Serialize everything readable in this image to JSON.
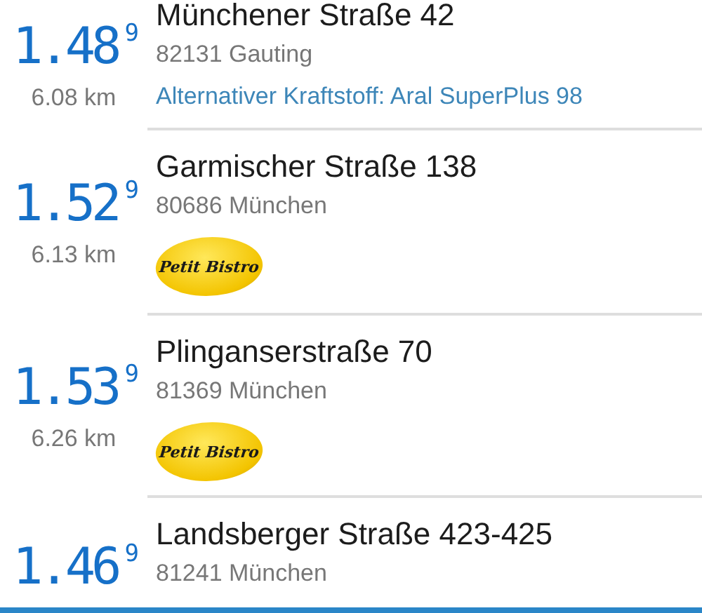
{
  "stations": [
    {
      "price": "1.48",
      "price_sup": "9",
      "distance": "6.08 km",
      "street": "Münchener Straße 42",
      "city": "82131 Gauting",
      "note": "Alternativer Kraftstoff: Aral SuperPlus 98"
    },
    {
      "price": "1.52",
      "price_sup": "9",
      "distance": "6.13 km",
      "street": "Garmischer Straße 138",
      "city": "80686 München",
      "badge": "Petit Bistro"
    },
    {
      "price": "1.53",
      "price_sup": "9",
      "distance": "6.26 km",
      "street": "Plinganserstraße 70",
      "city": "81369 München",
      "badge": "Petit Bistro"
    },
    {
      "price": "1.46",
      "price_sup": "9",
      "street": "Landsberger Straße 423-425",
      "city": "81241 München"
    }
  ]
}
